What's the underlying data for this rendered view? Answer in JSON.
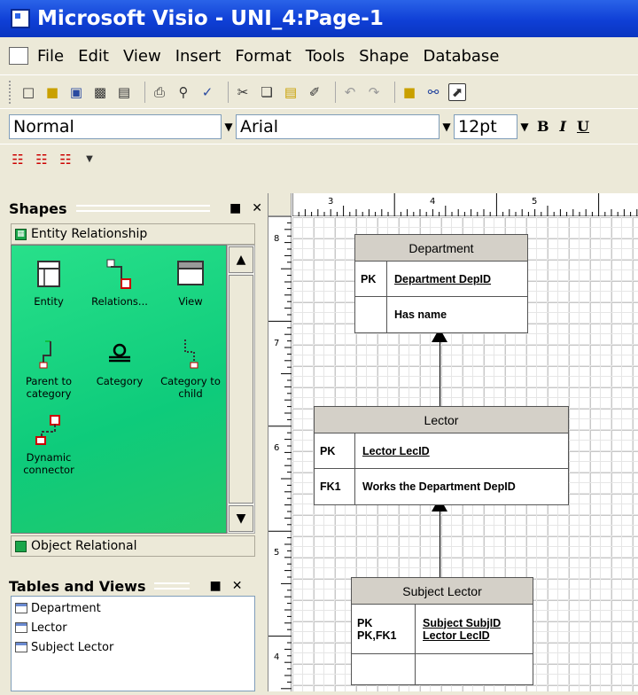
{
  "window": {
    "title": "Microsoft Visio - UNI_4:Page-1"
  },
  "menu": [
    "File",
    "Edit",
    "View",
    "Insert",
    "Format",
    "Tools",
    "Shape",
    "Database"
  ],
  "format_toolbar": {
    "style": "Normal",
    "font": "Arial",
    "size": "12pt",
    "bold": "B",
    "italic": "I",
    "underline": "U"
  },
  "shapes_panel": {
    "title": "Shapes",
    "stencil": "Entity Relationship",
    "masters": [
      {
        "label": "Entity",
        "icon": "entity-icon"
      },
      {
        "label": "Relations...",
        "icon": "relationship-icon"
      },
      {
        "label": "View",
        "icon": "view-icon"
      },
      {
        "label": "Parent to category",
        "icon": "parent-to-category-icon"
      },
      {
        "label": "Category",
        "icon": "category-icon"
      },
      {
        "label": "Category to child",
        "icon": "category-to-child-icon"
      },
      {
        "label": "Dynamic connector",
        "icon": "dynamic-connector-icon"
      }
    ],
    "stencil2": "Object Relational"
  },
  "tables_views": {
    "title": "Tables and Views",
    "items": [
      "Department",
      "Lector",
      "Subject Lector"
    ]
  },
  "ruler": {
    "h_labels": [
      "3",
      "4",
      "5"
    ],
    "v_labels": [
      "8",
      "7",
      "6",
      "5",
      "4"
    ]
  },
  "diagram": {
    "department": {
      "title": "Department",
      "key1": "PK",
      "attr1": "Department DepID",
      "attr2": "Has name"
    },
    "lector": {
      "title": "Lector",
      "key1": "PK",
      "attr1": "Lector LecID",
      "key2": "FK1",
      "attr2": "Works the Department DepID"
    },
    "subject_lector": {
      "title": "Subject Lector",
      "key1a": "PK",
      "key1b": "PK,FK1",
      "attr1a": "Subject SubjID",
      "attr1b": "Lector LecID"
    }
  }
}
